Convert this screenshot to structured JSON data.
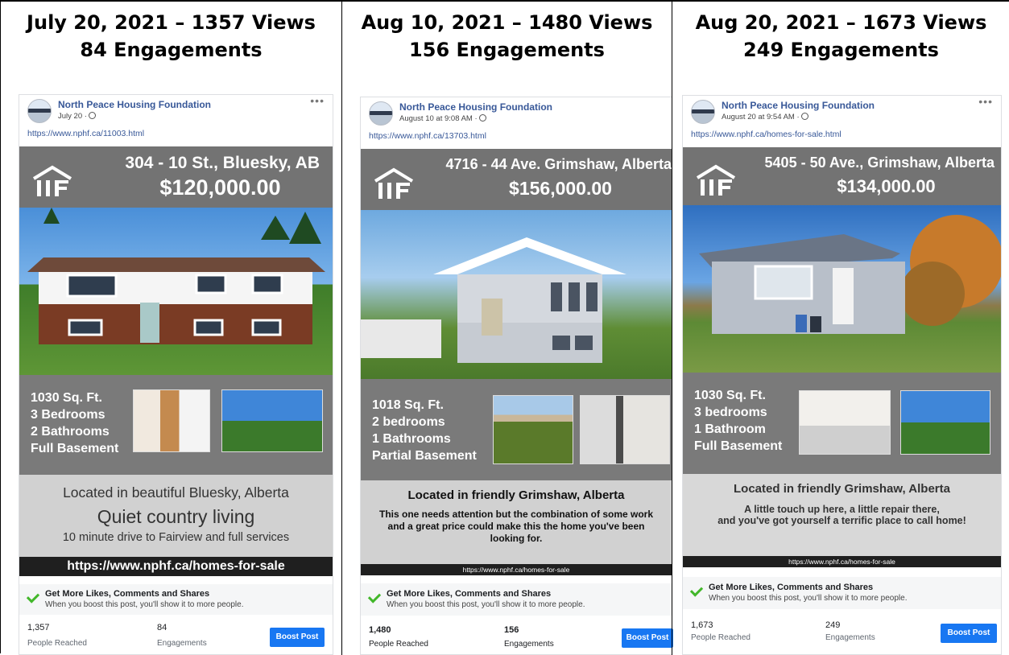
{
  "posts": [
    {
      "header_line1": "July 20, 2021 – 1357 Views",
      "header_line2": "84 Engagements",
      "page_name": "North Peace Housing Foundation",
      "post_date": "July 20 ·",
      "post_link": "https://www.nphf.ca/11003.html",
      "address": "304 - 10 St., Bluesky, AB",
      "price": "$120,000.00",
      "specs": [
        "1030 Sq. Ft.",
        "3 Bedrooms",
        "2 Bathrooms",
        "Full Basement"
      ],
      "location": "Located in beautiful Bluesky, Alberta",
      "tagline": "Quiet country living",
      "description": "10 minute drive to Fairview and full services",
      "listing_url": "https://www.nphf.ca/homes-for-sale",
      "boost_title": "Get More Likes, Comments and Shares",
      "boost_subtitle": "When you boost this post, you'll show it to more people.",
      "people_reached": "1,357",
      "people_reached_label": "People Reached",
      "engagements": "84",
      "engagements_label": "Engagements",
      "boost_button": "Boost Post"
    },
    {
      "header_line1": "Aug 10, 2021 – 1480 Views",
      "header_line2": "156 Engagements",
      "page_name": "North Peace Housing Foundation",
      "post_date": "August 10 at 9:08 AM ·",
      "post_link": "https://www.nphf.ca/13703.html",
      "address": "4716 - 44 Ave. Grimshaw, Alberta",
      "price": "$156,000.00",
      "specs": [
        "1018 Sq. Ft.",
        "2 bedrooms",
        "1 Bathrooms",
        "Partial Basement"
      ],
      "location": "Located in friendly Grimshaw, Alberta",
      "description": "This one needs attention but the combination of some work and a great price could make this the home you've been looking for.",
      "listing_url": "https://www.nphf.ca/homes-for-sale",
      "boost_title": "Get More Likes, Comments and Shares",
      "boost_subtitle": "When you boost this post, you'll show it to more people.",
      "people_reached": "1,480",
      "people_reached_label": "People Reached",
      "engagements": "156",
      "engagements_label": "Engagements",
      "boost_button": "Boost Post"
    },
    {
      "header_line1": "Aug 20, 2021 – 1673 Views",
      "header_line2": "249 Engagements",
      "page_name": "North Peace Housing Foundation",
      "post_date": "August 20 at 9:54 AM ·",
      "post_link": "https://www.nphf.ca/homes-for-sale.html",
      "address": "5405 - 50 Ave., Grimshaw, Alberta",
      "price": "$134,000.00",
      "specs": [
        "1030 Sq. Ft.",
        "3 bedrooms",
        "1 Bathroom",
        "Full Basement"
      ],
      "location": "Located in friendly Grimshaw, Alberta",
      "description_line1": "A little touch up here, a little repair there,",
      "description_line2": "and you've got yourself a terrific place to call home!",
      "listing_url": "https://www.nphf.ca/homes-for-sale",
      "boost_title": "Get More Likes, Comments and Shares",
      "boost_subtitle": "When you boost this post, you'll show it to more people.",
      "people_reached": "1,673",
      "people_reached_label": "People Reached",
      "engagements": "249",
      "engagements_label": "Engagements",
      "boost_button": "Boost Post"
    }
  ],
  "colors": {
    "link_blue": "#385898",
    "boost_blue": "#1877f2",
    "check_green": "#42b72a",
    "flyer_gray": "#737373",
    "url_bar": "#1f1f1f"
  }
}
